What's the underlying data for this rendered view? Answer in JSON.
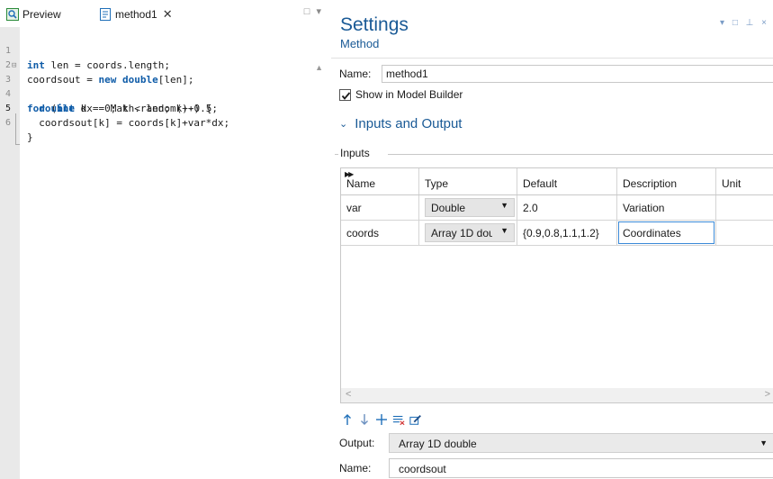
{
  "editor": {
    "tabs": [
      {
        "label": "Preview",
        "icon": "preview-icon"
      },
      {
        "label": "method1",
        "icon": "method-file-icon",
        "close": "✕"
      }
    ],
    "pane_menu": "□ ▾",
    "code_lines": [
      {
        "num": "1",
        "text": "int len = coords.length;"
      },
      {
        "num": "2",
        "text": "coordsout = new double[len];"
      },
      {
        "num": "3",
        "text": "for (int k = 0; k < len; k++) {",
        "fold": "⊟"
      },
      {
        "num": "4",
        "text": "  double dx = Math.random()-0.5;"
      },
      {
        "num": "5",
        "text": "  coordsout[k] = coords[k]+var*dx;"
      },
      {
        "num": "6",
        "text": "}"
      }
    ]
  },
  "settings": {
    "title": "Settings",
    "subtitle": "Method",
    "window_controls": "▾ □ ⊥ ×",
    "name_label": "Name:",
    "name_value": "method1",
    "show_in_model_builder": {
      "label": "Show in Model Builder",
      "checked": true
    },
    "section_title": "Inputs and Output",
    "inputs_group_label": "Inputs",
    "table": {
      "columns": [
        "Name",
        "Type",
        "Default",
        "Description",
        "Unit"
      ],
      "rows": [
        {
          "name": "var",
          "type": "Double",
          "default": "2.0",
          "description": "Variation",
          "unit": ""
        },
        {
          "name": "coords",
          "type": "Array 1D double",
          "default": "{0.9,0.8,1.1,1.2}",
          "description": "Coordinates",
          "unit": ""
        }
      ]
    },
    "toolbar_icons": [
      "move-up-icon",
      "move-down-icon",
      "add-icon",
      "delete-icon",
      "edit-icon"
    ],
    "output_label": "Output:",
    "output_value": "Array 1D double",
    "out_name_label": "Name:",
    "out_name_value": "coordsout"
  },
  "colors": {
    "accent_blue": "#1a5a96",
    "keyword_blue": "#0f5ca8",
    "icon_blue": "#1f6fb8",
    "gutter_gray": "#e9e9e9"
  }
}
